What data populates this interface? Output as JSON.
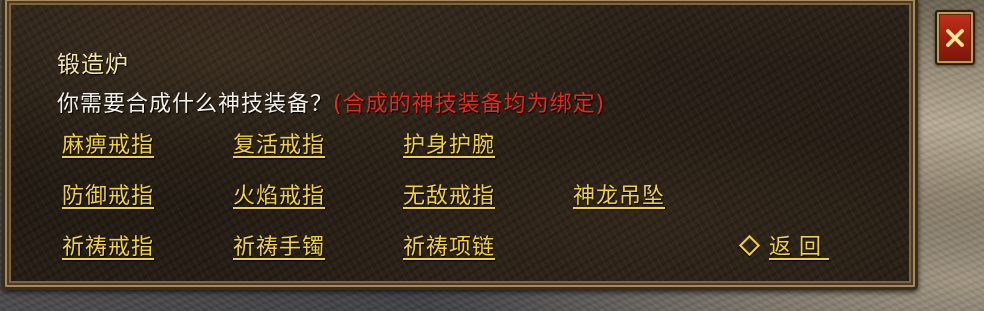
{
  "dialog": {
    "title": "锻造炉",
    "question": "你需要合成什么神技装备？",
    "note": "(合成的神技装备均为绑定)"
  },
  "options": [
    {
      "label": "麻痹戒指"
    },
    {
      "label": "复活戒指"
    },
    {
      "label": "护身护腕"
    },
    {
      "label": "防御戒指"
    },
    {
      "label": "火焰戒指"
    },
    {
      "label": "无敌戒指"
    },
    {
      "label": "神龙吊坠"
    },
    {
      "label": "祈祷戒指"
    },
    {
      "label": "祈祷手镯"
    },
    {
      "label": "祈祷项链"
    }
  ],
  "back_label": "返回",
  "colors": {
    "title": "#f4e6a6",
    "option": "#f1d23a",
    "note": "#e8281c",
    "close_button": "#b02814"
  },
  "icons": {
    "close": "close-icon",
    "back": "diamond-bullet-icon"
  }
}
